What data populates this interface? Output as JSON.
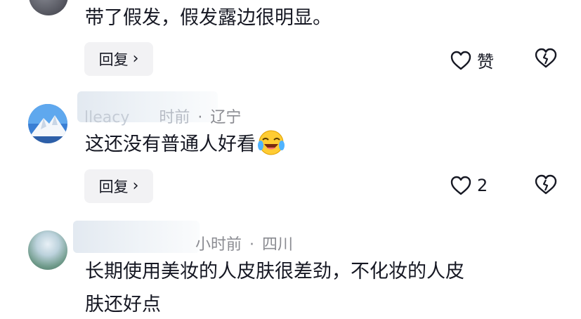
{
  "comments": [
    {
      "text": "带了假发，假发露边很明显。",
      "reply_label": "回复",
      "like_label": "赞",
      "like_count": null
    },
    {
      "username_partial": "lleacy",
      "time_partial": "时前",
      "location": "辽宁",
      "separator": "·",
      "text": "这还没有普通人好看",
      "emoji": "laughing-crying-emoji",
      "reply_label": "回复",
      "like_count": "2"
    },
    {
      "time_partial": "小时前",
      "location": "四川",
      "separator": "·",
      "text_line1": "长期使用美妆的人皮肤很差劲，不化妆的人皮",
      "text_line2": "肤还好点"
    }
  ],
  "colors": {
    "text": "#161823",
    "meta": "#8a8b91",
    "reply_bg": "#f2f2f4"
  }
}
